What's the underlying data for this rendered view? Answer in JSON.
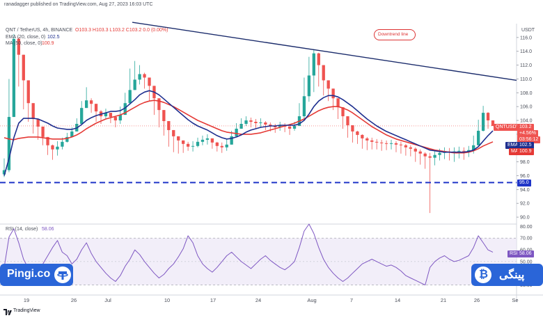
{
  "header": {
    "publisher": "ranadagger published on TradingView.com, Aug 27, 2023 16:03 UTC",
    "symbol_line": "QNT / TetherUS, 4h, BINANCE",
    "ohlc": "O103.3  H103.3  L103.2  C103.2  0.0 (0.00%)",
    "ema_line": "EMA (20, close, 0)",
    "ema_value": "102.5",
    "ma_line": "MA (50, close, 0)",
    "ma_value": "100.9",
    "rsi_line": "RSI (14, close)",
    "rsi_value": "58.06",
    "currency": "USDT"
  },
  "annotation": {
    "text": "Downtrend line"
  },
  "price_tags": {
    "symbol": "QNTUSDT",
    "price": "103.2",
    "change": "+4.56%",
    "countdown": "03:56:12",
    "ema_label": "EMA",
    "ema": "102.5",
    "ma_label": "MA",
    "ma": "100.9",
    "support": "95.0",
    "rsi_label": "RSI",
    "rsi": "58.06"
  },
  "footer": {
    "logo_text": "TradingView"
  },
  "branding": {
    "left_name": "Pingi.co",
    "right_name": "پینگی"
  },
  "colors": {
    "up": "#26a69a",
    "down": "#ef5350",
    "ema": "#1e2f8f",
    "ma": "#e53935",
    "trendline": "#1a2b6b",
    "support": "#1f35c8",
    "rsi": "#7e57c2",
    "brand": "#2a65d8"
  },
  "chart_data": [
    {
      "type": "candlestick",
      "title": "QNT / TetherUS, 4h, BINANCE",
      "ylabel": "USDT",
      "ylim": [
        89,
        118
      ],
      "x_ticks": [
        "19",
        "26",
        "Jul",
        "10",
        "17",
        "24",
        "Aug",
        "7",
        "14",
        "21",
        "26",
        "Se"
      ],
      "y_ticks": [
        90.0,
        92.0,
        94.0,
        96.0,
        98.0,
        100.0,
        102.0,
        104.0,
        106.0,
        108.0,
        110.0,
        112.0,
        114.0,
        116.0
      ],
      "trendline": {
        "label": "Downtrend line",
        "start": {
          "x": "Jun 30",
          "y": 118.2
        },
        "end": {
          "x": "Sep 3",
          "y": 109.8
        }
      },
      "support": {
        "y": 95.0
      },
      "price_close": [
        96.8,
        104.5,
        115.8,
        113.5,
        109.8,
        106.5,
        104.2,
        103.1,
        101.6,
        100.4,
        99.8,
        100.2,
        100.9,
        101.6,
        102.4,
        103.5,
        105.8,
        106.9,
        106.4,
        105.3,
        104.6,
        105.1,
        104.5,
        104.0,
        104.8,
        106.5,
        108.4,
        109.9,
        110.7,
        110.2,
        109.0,
        107.2,
        105.5,
        103.9,
        102.6,
        101.7,
        101.1,
        100.6,
        100.2,
        100.3,
        100.9,
        101.2,
        101.4,
        100.8,
        100.3,
        100.1,
        100.5,
        101.7,
        102.8,
        103.5,
        104.0,
        103.8,
        103.6,
        103.7,
        103.4,
        103.2,
        103.0,
        103.3,
        103.1,
        102.8,
        103.2,
        104.6,
        107.5,
        110.5,
        113.7,
        112.0,
        109.8,
        108.6,
        107.2,
        105.9,
        104.6,
        103.3,
        102.4,
        101.9,
        101.4,
        101.1,
        100.9,
        100.8,
        100.7,
        100.6,
        100.7,
        100.5,
        100.4,
        100.1,
        99.9,
        99.5,
        99.2,
        98.8,
        98.6,
        99.0,
        99.3,
        99.5,
        99.4,
        99.5,
        99.6,
        99.5,
        99.7,
        100.4,
        102.5,
        105.1,
        104.0,
        103.2
      ],
      "price_high": [
        98.5,
        110.0,
        116.5,
        116.0,
        110.8,
        107.2,
        105.0,
        103.6,
        102.0,
        101.0,
        100.5,
        101.0,
        101.5,
        102.2,
        103.0,
        104.3,
        106.8,
        108.8,
        107.2,
        106.0,
        105.5,
        105.7,
        105.0,
        104.6,
        106.0,
        108.0,
        111.5,
        112.6,
        112.0,
        110.9,
        109.6,
        107.8,
        106.0,
        104.5,
        103.2,
        102.2,
        101.6,
        101.1,
        100.9,
        101.0,
        101.5,
        101.8,
        102.0,
        101.2,
        100.9,
        100.8,
        101.3,
        102.5,
        103.6,
        104.3,
        104.6,
        104.4,
        104.2,
        104.3,
        103.9,
        103.7,
        103.5,
        103.8,
        103.6,
        103.4,
        103.8,
        106.5,
        110.2,
        113.2,
        114.3,
        113.8,
        110.8,
        109.3,
        107.9,
        106.4,
        105.2,
        104.0,
        103.0,
        102.5,
        102.0,
        101.6,
        101.5,
        101.3,
        101.2,
        101.1,
        101.2,
        101.0,
        100.9,
        100.6,
        100.4,
        100.1,
        99.8,
        99.4,
        99.3,
        99.6,
        99.9,
        100.1,
        100.0,
        100.1,
        100.2,
        100.1,
        100.3,
        101.8,
        104.1,
        106.1,
        105.2,
        103.3
      ],
      "price_low": [
        95.8,
        96.5,
        108.3,
        108.9,
        105.6,
        103.8,
        102.1,
        101.2,
        100.4,
        99.0,
        98.3,
        98.9,
        99.8,
        100.8,
        101.6,
        102.6,
        104.5,
        105.9,
        105.1,
        103.8,
        103.5,
        104.2,
        103.6,
        103.0,
        103.5,
        104.8,
        106.3,
        108.5,
        109.2,
        108.6,
        106.8,
        104.8,
        103.0,
        101.8,
        100.2,
        99.4,
        99.2,
        99.3,
        99.6,
        99.5,
        100.1,
        100.4,
        100.5,
        99.9,
        99.5,
        99.3,
        99.6,
        100.5,
        101.9,
        102.8,
        103.2,
        103.0,
        102.8,
        102.9,
        102.6,
        102.4,
        102.2,
        102.5,
        102.3,
        101.9,
        102.5,
        103.4,
        104.0,
        106.7,
        108.1,
        108.9,
        107.6,
        106.8,
        105.5,
        104.2,
        102.8,
        101.5,
        100.8,
        100.6,
        99.9,
        99.7,
        99.8,
        99.8,
        99.6,
        99.7,
        99.8,
        99.4,
        99.2,
        98.9,
        98.8,
        98.0,
        97.6,
        97.0,
        90.6,
        97.5,
        98.2,
        98.4,
        98.2,
        98.0,
        98.5,
        98.3,
        98.7,
        99.2,
        100.8,
        102.4,
        102.8,
        103.2
      ],
      "ema20": [
        96.0,
        98.5,
        101.5,
        103.6,
        104.3,
        104.3,
        104.3,
        104.2,
        103.9,
        103.6,
        103.2,
        102.9,
        102.8,
        102.7,
        102.7,
        102.9,
        103.4,
        104.0,
        104.4,
        104.7,
        104.9,
        105.1,
        105.3,
        105.3,
        105.4,
        105.8,
        106.4,
        107.0,
        107.7,
        108.1,
        108.3,
        108.1,
        107.7,
        107.1,
        106.5,
        105.9,
        105.3,
        104.7,
        104.1,
        103.6,
        103.2,
        102.9,
        102.6,
        102.2,
        101.8,
        101.5,
        101.3,
        101.4,
        101.6,
        101.9,
        102.3,
        102.6,
        102.8,
        103.0,
        103.1,
        103.2,
        103.2,
        103.3,
        103.3,
        103.3,
        103.3,
        103.5,
        104.0,
        104.9,
        106.0,
        106.8,
        107.3,
        107.6,
        107.6,
        107.4,
        107.0,
        106.5,
        106.0,
        105.4,
        104.8,
        104.2,
        103.7,
        103.2,
        102.8,
        102.4,
        102.1,
        101.8,
        101.5,
        101.2,
        100.9,
        100.6,
        100.3,
        100.0,
        99.7,
        99.6,
        99.5,
        99.4,
        99.4,
        99.4,
        99.4,
        99.4,
        99.5,
        99.7,
        100.2,
        101.0,
        101.8,
        102.5
      ],
      "ma50": [
        101.5,
        101.3,
        101.2,
        101.4,
        101.5,
        101.6,
        101.6,
        101.6,
        101.5,
        101.4,
        101.3,
        101.3,
        101.3,
        101.4,
        101.6,
        101.9,
        102.3,
        102.8,
        103.2,
        103.6,
        103.9,
        104.2,
        104.4,
        104.6,
        104.8,
        105.1,
        105.5,
        105.9,
        106.3,
        106.6,
        106.8,
        106.9,
        106.8,
        106.6,
        106.3,
        106.0,
        105.6,
        105.2,
        104.8,
        104.4,
        104.0,
        103.7,
        103.4,
        103.1,
        102.8,
        102.5,
        102.3,
        102.2,
        102.1,
        102.0,
        102.0,
        102.0,
        102.1,
        102.2,
        102.4,
        102.6,
        102.8,
        103.0,
        103.2,
        103.4,
        103.6,
        103.9,
        104.2,
        104.6,
        105.0,
        105.4,
        105.7,
        105.9,
        106.0,
        106.0,
        105.8,
        105.5,
        105.1,
        104.6,
        104.1,
        103.6,
        103.1,
        102.7,
        102.3,
        101.9,
        101.6,
        101.3,
        101.1,
        100.9,
        100.7,
        100.5,
        100.3,
        100.1,
        99.9,
        99.7,
        99.6,
        99.5,
        99.4,
        99.3,
        99.3,
        99.3,
        99.4,
        99.6,
        99.9,
        100.3,
        100.6,
        100.9
      ]
    },
    {
      "type": "line",
      "title": "RSI (14, close)",
      "ylim": [
        25,
        82
      ],
      "y_ticks": [
        30.0,
        40.0,
        50.0,
        60.0,
        70.0,
        80.0
      ],
      "bands": [
        30,
        70
      ],
      "series": [
        {
          "name": "RSI",
          "values": [
            45,
            71,
            78,
            66,
            52,
            44,
            40,
            43,
            48,
            55,
            62,
            68,
            58,
            55,
            48,
            52,
            60,
            66,
            57,
            50,
            45,
            40,
            36,
            33,
            38,
            46,
            52,
            60,
            56,
            50,
            45,
            40,
            36,
            39,
            44,
            48,
            54,
            61,
            72,
            66,
            55,
            48,
            44,
            41,
            45,
            50,
            55,
            58,
            54,
            50,
            47,
            44,
            48,
            52,
            55,
            51,
            48,
            45,
            43,
            46,
            50,
            62,
            76,
            82,
            74,
            62,
            52,
            45,
            40,
            36,
            33,
            36,
            40,
            44,
            48,
            50,
            52,
            50,
            48,
            46,
            47,
            45,
            42,
            38,
            36,
            34,
            32,
            30,
            45,
            50,
            53,
            55,
            52,
            50,
            51,
            53,
            55,
            62,
            72,
            66,
            60,
            58
          ]
        }
      ]
    }
  ]
}
